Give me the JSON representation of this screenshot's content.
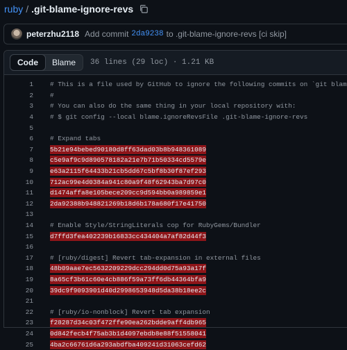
{
  "breadcrumb": {
    "repo": "ruby",
    "sep": "/",
    "file": ".git-blame-ignore-revs",
    "copy_icon": "copy-icon"
  },
  "commit": {
    "author": "peterzhu2118",
    "prefix": "Add commit",
    "hash": "2da9238",
    "suffix": "to .git-blame-ignore-revs [ci skip]"
  },
  "file_header": {
    "code_tab": "Code",
    "blame_tab": "Blame",
    "info": "36 lines (29 loc) · 1.21 KB"
  },
  "lines": [
    {
      "n": "1",
      "t": "# This is a file used by GitHub to ignore the following commits on `git blame`.",
      "kind": "comment"
    },
    {
      "n": "2",
      "t": "#",
      "kind": "comment"
    },
    {
      "n": "3",
      "t": "# You can also do the same thing in your local repository with:",
      "kind": "comment"
    },
    {
      "n": "4",
      "t": "# $ git config --local blame.ignoreRevsFile .git-blame-ignore-revs",
      "kind": "comment"
    },
    {
      "n": "5",
      "t": "",
      "kind": "blank"
    },
    {
      "n": "6",
      "t": "# Expand tabs",
      "kind": "comment"
    },
    {
      "n": "7",
      "t": "5b21e94bebed90180d8ff63dad03b8b948361089",
      "kind": "hash"
    },
    {
      "n": "8",
      "t": "c5e9af9c9d890578182a21e7b71b50334cd5579e",
      "kind": "hash"
    },
    {
      "n": "9",
      "t": "e63a2115f64433b21cb5dd67c5bf8b30f87ef293",
      "kind": "hash"
    },
    {
      "n": "10",
      "t": "712ac99e4d0384a941c80a9f48f62943ba7d97c0",
      "kind": "hash"
    },
    {
      "n": "11",
      "t": "d1474affa8e105bece209cc9d594bb0a989859e1",
      "kind": "hash"
    },
    {
      "n": "12",
      "t": "2da92388b948821269b18d6b178a680f17e41750",
      "kind": "hash"
    },
    {
      "n": "13",
      "t": "",
      "kind": "blank"
    },
    {
      "n": "14",
      "t": "# Enable Style/StringLiterals cop for RubyGems/Bundler",
      "kind": "comment"
    },
    {
      "n": "15",
      "t": "d7ffd3fea402239b16833cc434404a7af82d44f3",
      "kind": "hash"
    },
    {
      "n": "16",
      "t": "",
      "kind": "blank"
    },
    {
      "n": "17",
      "t": "# [ruby/digest] Revert tab-expansion in external files",
      "kind": "comment"
    },
    {
      "n": "18",
      "t": "48b09aae7ec5632209229dcc294dd0d75a93a17f",
      "kind": "hash"
    },
    {
      "n": "19",
      "t": "8a65cf3b61c60e4cb886f59a73ff6db44364bfa9",
      "kind": "hash"
    },
    {
      "n": "20",
      "t": "39dc9f9093901d40d2998653948d5da38b18ee2c",
      "kind": "hash"
    },
    {
      "n": "21",
      "t": "",
      "kind": "blank"
    },
    {
      "n": "22",
      "t": "# [ruby/io-nonblock] Revert tab expansion",
      "kind": "comment"
    },
    {
      "n": "23",
      "t": "f28287d34c03f472ffe90ea262bdde9aff4db965",
      "kind": "hash"
    },
    {
      "n": "24",
      "t": "0d842fecb4f75ab3b1d4097ebdb8e88f51558041",
      "kind": "hash"
    },
    {
      "n": "25",
      "t": "4ba2c66761d6a293abdfba409241d31063cefd62",
      "kind": "hash"
    }
  ]
}
